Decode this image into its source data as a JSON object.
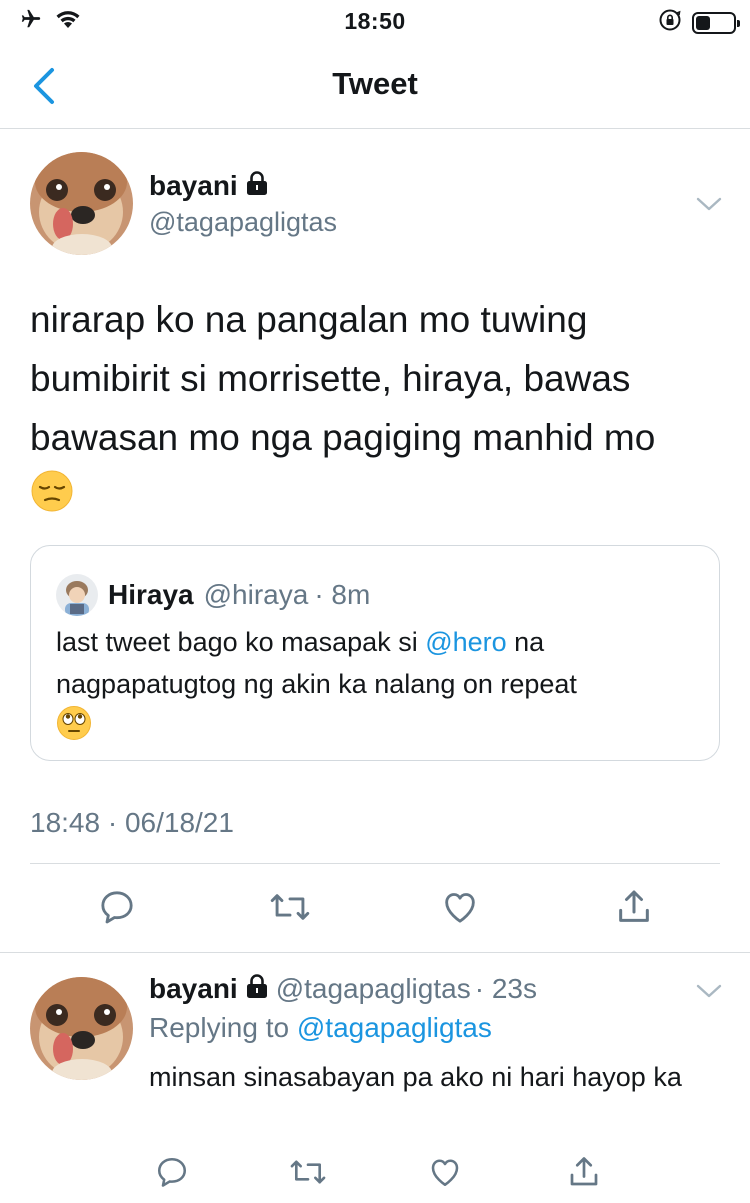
{
  "status_bar": {
    "time": "18:50",
    "icons": [
      "airplane-icon",
      "wifi-icon",
      "orientation-lock-icon",
      "battery-icon"
    ]
  },
  "nav": {
    "title": "Tweet",
    "back_icon": "chevron-left-icon"
  },
  "tweet": {
    "author_name": "bayani",
    "author_handle": "@tagapagligtas",
    "protected_icon": "lock-icon",
    "text": "nirarap ko na pangalan mo tuwing bumibirit si morrisette, hiraya, bawas bawasan mo nga pagiging manhid mo",
    "text_emoji": "pensive-face-emoji",
    "timestamp": "18:48 · 06/18/21"
  },
  "quoted_tweet": {
    "author_name": "Hiraya",
    "author_handle": "@hiraya",
    "time": "· 8m",
    "text_before": "last tweet bago ko masapak si ",
    "mention": "@hero",
    "text_after": " na nagpapatugtog ng akin ka nalang on repeat",
    "text_emoji": "face-with-rolling-eyes-emoji"
  },
  "actions": [
    "reply-icon",
    "retweet-icon",
    "like-icon",
    "share-icon"
  ],
  "reply": {
    "author_name": "bayani",
    "author_handle": "@tagapagligtas",
    "time": "· 23s",
    "replying_label": "Replying to",
    "replying_handle": "@tagapagligtas",
    "text": "minsan sinasabayan pa ako ni hari hayop ka"
  },
  "colors": {
    "text": "#14171a",
    "secondary": "#657786",
    "accent": "#1b95e0",
    "border": "#d9dde0"
  }
}
